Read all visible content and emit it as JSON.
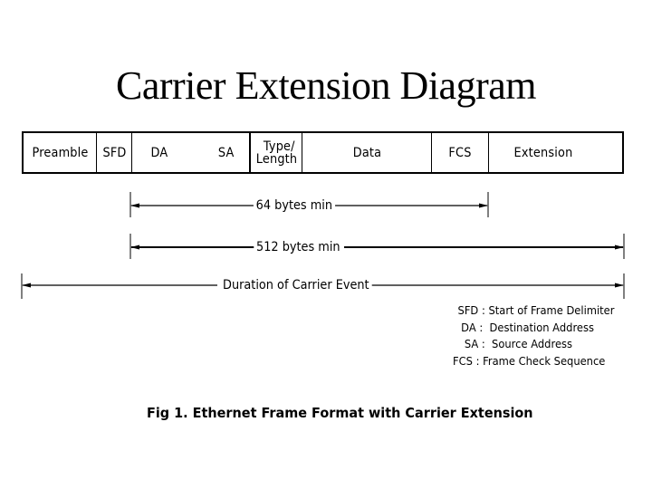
{
  "title": "Carrier Extension Diagram",
  "frame": {
    "fields": [
      {
        "key": "preamble",
        "label": "Preamble"
      },
      {
        "key": "sfd",
        "label": "SFD"
      },
      {
        "key": "da",
        "label": "DA"
      },
      {
        "key": "sa",
        "label": "SA"
      },
      {
        "key": "type_length",
        "label_line1": "Type/",
        "label_line2": "Length"
      },
      {
        "key": "data",
        "label": "Data"
      },
      {
        "key": "fcs",
        "label": "FCS"
      },
      {
        "key": "extension",
        "label": "Extension"
      }
    ]
  },
  "dimensions": {
    "min64": "64 bytes min",
    "min512": "512 bytes min",
    "carrier_event": "Duration of Carrier Event"
  },
  "legend": [
    {
      "abbr": "SFD",
      "text": "SFD : Start of Frame Delimiter"
    },
    {
      "abbr": "DA",
      "text": " DA :  Destination Address"
    },
    {
      "abbr": "SA",
      "text": "  SA :  Source Address"
    },
    {
      "abbr": "FCS",
      "text": "FCS : Frame Check Sequence"
    }
  ],
  "caption": "Fig 1. Ethernet Frame Format with Carrier Extension"
}
